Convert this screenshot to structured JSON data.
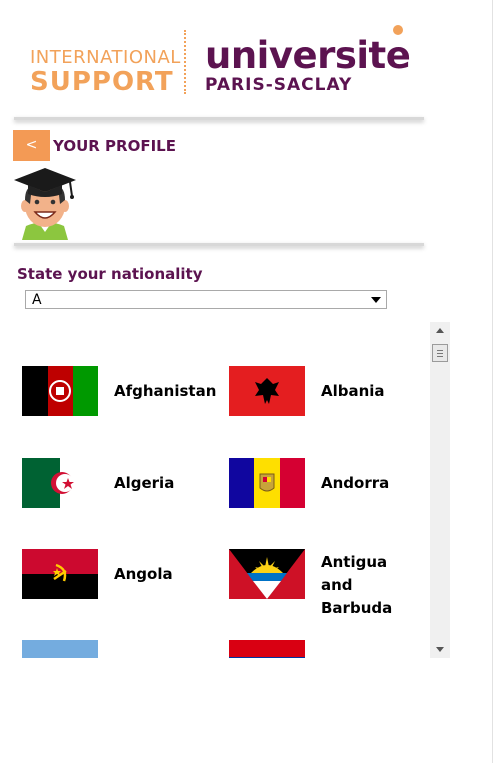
{
  "logo": {
    "international_line1": "INTERNATIONAL",
    "international_line2": "SUPPORT",
    "universite_line1": "universite",
    "universite_line2": "PARIS-SACLAY"
  },
  "profile": {
    "back_label": "<",
    "title": "YOUR PROFILE"
  },
  "nationality": {
    "label": "State your nationality",
    "selected": "A"
  },
  "countries": [
    {
      "name": "Afghanistan"
    },
    {
      "name": "Albania"
    },
    {
      "name": "Algeria"
    },
    {
      "name": "Andorra"
    },
    {
      "name": "Angola"
    },
    {
      "name": "Antigua and Barbuda"
    }
  ],
  "icons": {
    "avatar": "graduate-avatar-icon",
    "back": "back-button",
    "dropdown": "chevron-down-icon",
    "scroll_up": "scroll-up-icon",
    "scroll_down": "scroll-down-icon"
  },
  "colors": {
    "accent_orange": "#f39a55",
    "brand_purple": "#5c1350"
  }
}
